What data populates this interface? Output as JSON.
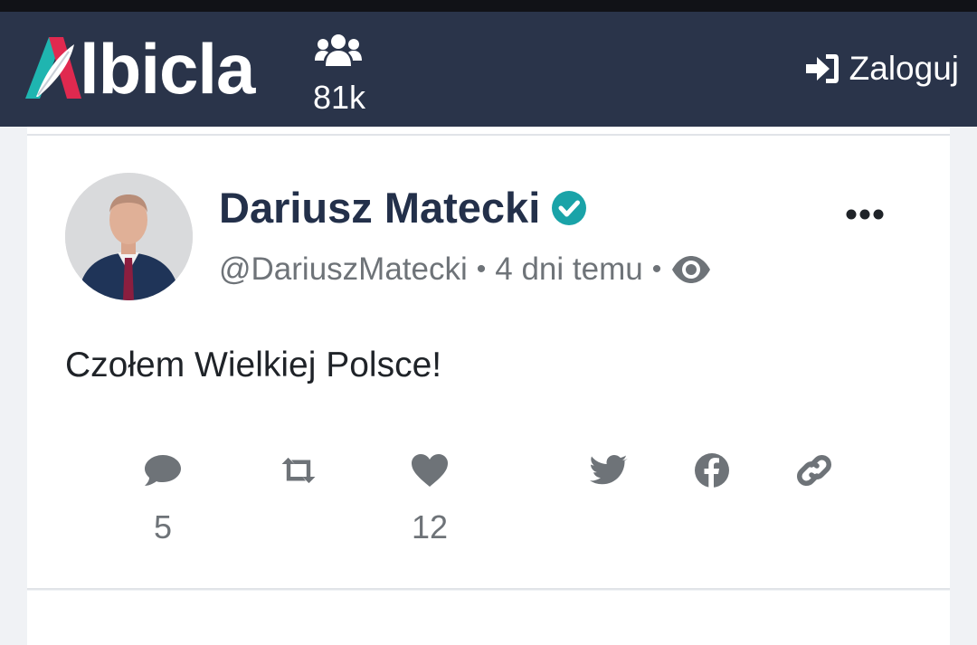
{
  "header": {
    "logo_text": "lbicla",
    "logo_full": "Albicla",
    "users_count": "81k",
    "login_label": "Zaloguj"
  },
  "post": {
    "author_name": "Dariusz Matecki",
    "handle": "@DariuszMatecki",
    "time": "4 dni temu",
    "separator": "•",
    "text": "Czołem Wielkiej Polsce!",
    "comments_count": "5",
    "likes_count": "12"
  },
  "icons": {
    "users": "users-icon",
    "login": "sign-in-icon",
    "verified": "verified-check-icon",
    "more": "ellipsis-icon",
    "views": "eye-icon",
    "comment": "comment-icon",
    "repost": "retweet-icon",
    "like": "heart-icon",
    "twitter": "twitter-icon",
    "facebook": "facebook-icon",
    "link": "link-icon"
  },
  "colors": {
    "navbar": "#2a344a",
    "verified": "#1aa3a8",
    "logo_teal": "#1fb5b0",
    "logo_pink": "#e0294f",
    "icon_gray": "#6e7378",
    "name": "#23304a"
  }
}
